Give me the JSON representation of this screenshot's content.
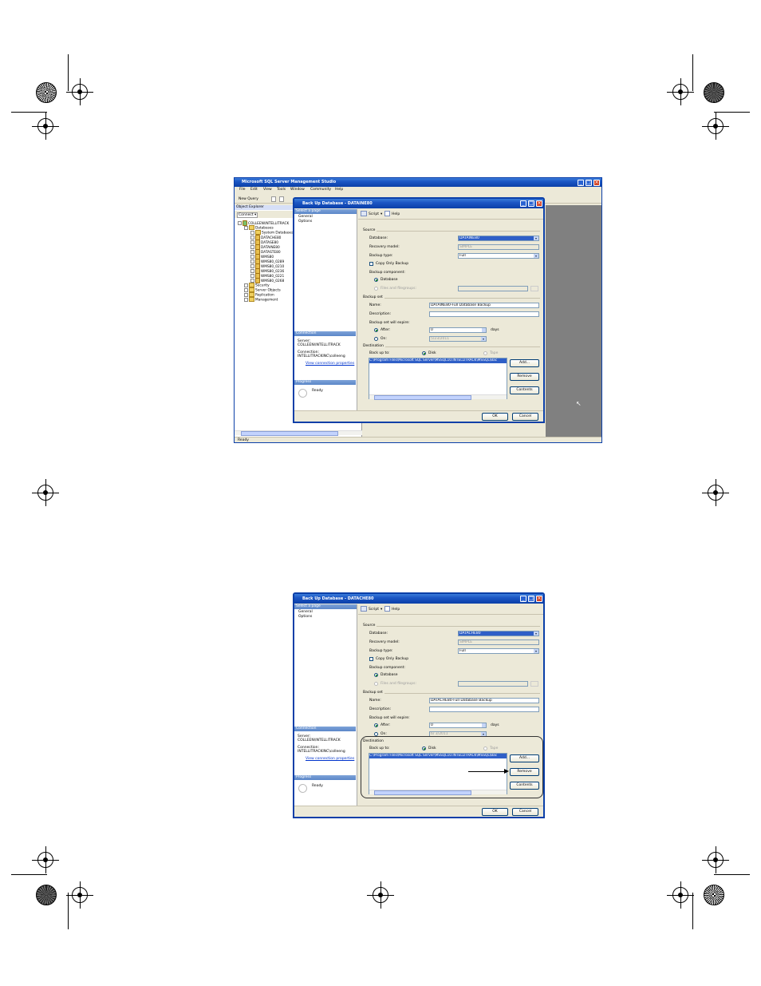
{
  "ssms": {
    "title": "Microsoft SQL Server Management Studio",
    "menu": [
      "File",
      "Edit",
      "View",
      "Tools",
      "Window",
      "Community",
      "Help"
    ],
    "toolbar_new_query": "New Query",
    "object_explorer": "Object Explorer",
    "connect": "Connect ▾",
    "tree": {
      "server": "COLLEEN\\INTELLITRACK",
      "databases": "Databases",
      "items": [
        "System Databases",
        "DATACHE80",
        "DATASE80",
        "DATAINE80",
        "DATASTE80",
        "WMS80",
        "WMS80_0289",
        "WMS80_0210",
        "WMS80_0236",
        "WMS80_0221",
        "WMS80_0268"
      ],
      "others": [
        "Security",
        "Server Objects",
        "Replication",
        "Management"
      ]
    },
    "status": "Ready"
  },
  "dialogs": [
    {
      "title": "Back Up Database - DATAINE80",
      "database": "DATAINE80",
      "backup_name": "DATAINE80-Full Database Backup",
      "date": "5/23/2011"
    },
    {
      "title": "Back Up Database - DATACHE80",
      "database": "DATACHE80",
      "backup_name": "DATACHE80-Full Database Backup",
      "date": "6/ 3/2011"
    }
  ],
  "dialog_common": {
    "select_page": "Select a page",
    "pages": [
      "General",
      "Options"
    ],
    "script": "Script",
    "help": "Help",
    "source": "Source",
    "database_label": "Database:",
    "recovery_label": "Recovery model:",
    "recovery_value": "SIMPLE",
    "backup_type_label": "Backup type:",
    "backup_type_value": "Full",
    "copy_only": "Copy Only Backup",
    "backup_component": "Backup component:",
    "component_database": "Database",
    "component_files": "Files and filegroups:",
    "backup_set": "Backup set",
    "name_label": "Name:",
    "description_label": "Description:",
    "expire_label": "Backup set will expire:",
    "after_label": "After:",
    "after_value": "0",
    "days": "days",
    "on_label": "On:",
    "destination": "Destination",
    "back_up_to": "Back up to:",
    "disk": "Disk",
    "tape": "Tape",
    "dest_path": "C:\\Program Files\\Microsoft SQL Server\\MSSQL10.INTELLITRACK\\MSSQL\\Bac",
    "add": "Add...",
    "remove": "Remove",
    "contents": "Contents",
    "connection": "Connection",
    "server_label": "Server:",
    "server_value": "COLLEEN\\INTELLITRACK",
    "connection_label": "Connection:",
    "connection_value": "INTELLITRACKINC\\colleeng",
    "view_props": "View connection properties",
    "progress": "Progress",
    "ready": "Ready",
    "ok": "OK",
    "cancel": "Cancel"
  },
  "colors": {
    "xp_title": "#1b56c4",
    "dialog_bg": "#ece9d8",
    "selection": "#2f5fc7",
    "mdi_bg": "#808080"
  }
}
